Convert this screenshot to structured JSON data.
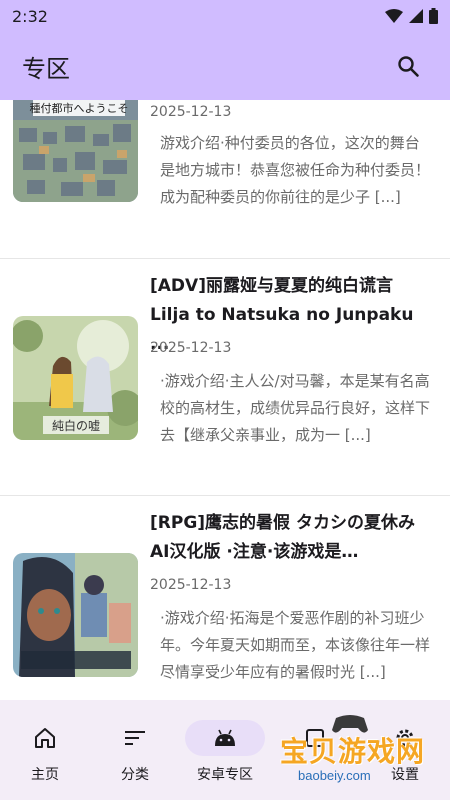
{
  "status_bar": {
    "time": "2:32"
  },
  "app_bar": {
    "title": "专区"
  },
  "items": [
    {
      "thumb_text": "種付都市へようこそ",
      "title": "",
      "date": "2025-12-13",
      "desc": "游戏介绍·种付委员的各位，这次的舞台是地方城市！恭喜您被任命为种付委员！成为配种委员的你前往的是少子 [...]"
    },
    {
      "thumb_text": "純白の嘘",
      "title": "[ADV]丽露娅与夏夏的纯白谎言 Lilja to Natsuka no Junpaku ...",
      "date": "2025-12-13",
      "desc": "·游戏介绍·主人公/对马馨，本是某有名高校的高材生，成绩优异品行良好，这样下去【继承父亲事业，成为一 [...]"
    },
    {
      "thumb_text": "",
      "title": "[RPG]鹰志的暑假 タカシの夏休み AI汉化版 ·注意·该游戏是…",
      "date": "2025-12-13",
      "desc": "·游戏介绍·拓海是个爱恶作剧的补习班少年。今年夏天如期而至，本该像往年一样尽情享受少年应有的暑假时光 [...]"
    }
  ],
  "bottom_nav": [
    {
      "label": "主页",
      "icon": "home-icon"
    },
    {
      "label": "分类",
      "icon": "sort-icon"
    },
    {
      "label": "安卓专区",
      "icon": "android-icon",
      "active": true
    },
    {
      "label": "",
      "icon": "app-icon"
    },
    {
      "label": "设置",
      "icon": "gear-icon"
    }
  ],
  "watermark": {
    "title": "宝贝游戏网",
    "url": "baobeiy.com"
  },
  "colors": {
    "primary": "#d0bcff",
    "nav_bg": "#f3edf7",
    "active_pill": "#e8def8",
    "watermark": "#f5a623"
  }
}
